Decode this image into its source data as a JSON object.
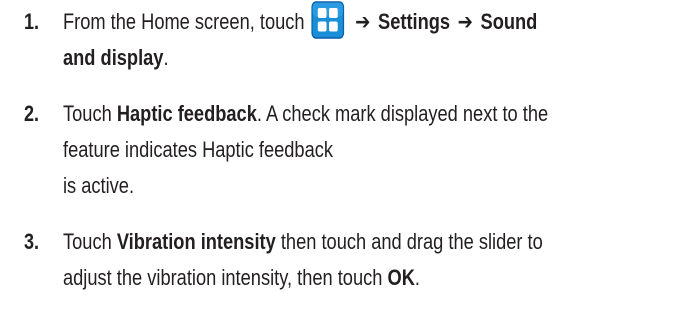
{
  "steps": [
    {
      "number": "1.",
      "line1_before_icon": "From the Home screen, touch",
      "icon": "apps-grid-icon",
      "arrow_1": "➔",
      "settings": "Settings",
      "arrow_2": "➔",
      "sound": "Sound",
      "line2_bold": "and display",
      "line2_end": "."
    },
    {
      "number": "2.",
      "touch": "Touch",
      "bold": "Haptic feedback",
      "rest_line1": ". A check mark displayed next to the",
      "line2": "feature indicates Haptic feedback",
      "line3": "is active."
    },
    {
      "number": "3.",
      "touch": "Touch",
      "bold": "Vibration intensity",
      "rest_line1": "then touch and drag the slider to",
      "line2_before": "adjust the vibration intensity, then touch",
      "ok": "OK",
      "line2_end": "."
    }
  ],
  "icon_colors": {
    "tile_background": "#1a8fd8",
    "tile_border": "#0b5ea8",
    "grid_squares": "#ffffff"
  }
}
